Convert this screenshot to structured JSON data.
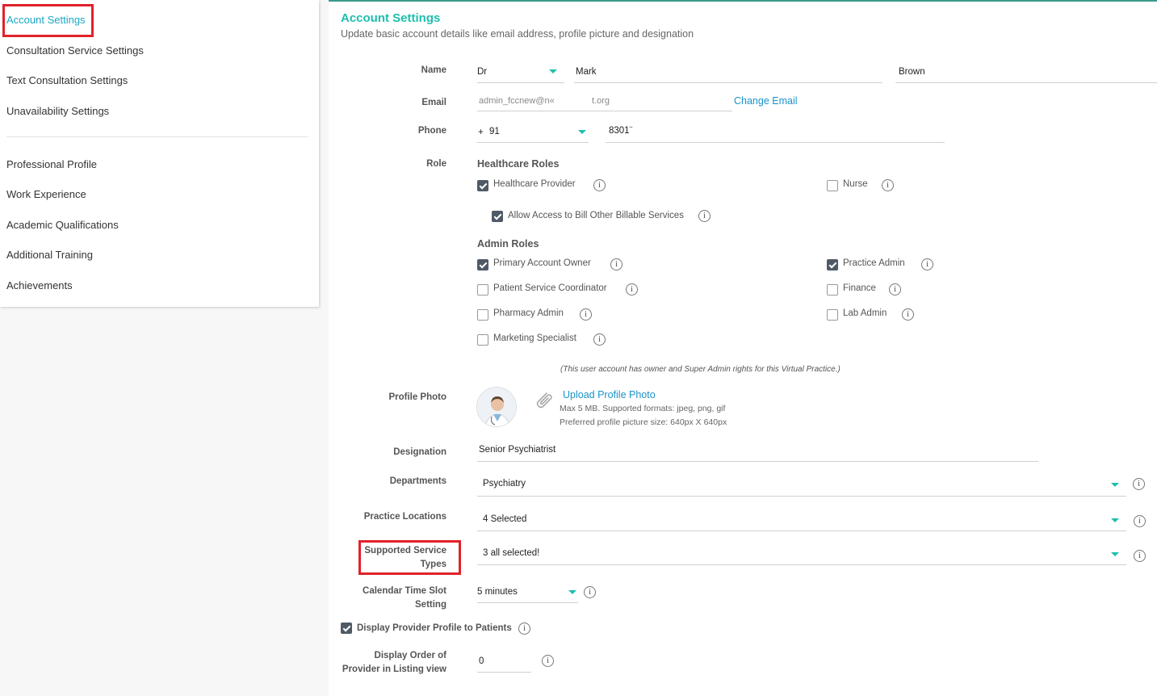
{
  "sidebar": {
    "items": [
      {
        "label": "Account Settings",
        "active": true
      },
      {
        "label": "Consultation Service Settings"
      },
      {
        "label": "Text Consultation Settings"
      },
      {
        "label": "Unavailability Settings"
      },
      {
        "label": "Professional Profile"
      },
      {
        "label": "Work Experience"
      },
      {
        "label": "Academic Qualifications"
      },
      {
        "label": "Additional Training"
      },
      {
        "label": "Achievements"
      }
    ]
  },
  "header": {
    "title": "Account Settings",
    "subtitle": "Update basic account details like email address, profile picture and designation"
  },
  "form": {
    "name": {
      "label": "Name",
      "prefix": "Dr",
      "first": "Mark",
      "last": "Brown"
    },
    "email": {
      "label": "Email",
      "value_start": "admin_fccnew@n«",
      "value_end": "t.org",
      "change_link": "Change Email"
    },
    "phone": {
      "label": "Phone",
      "plus": "+",
      "code": "91",
      "number": "8301¨"
    },
    "role": {
      "label": "Role",
      "healthcare_heading": "Healthcare Roles",
      "healthcare_provider": {
        "label": "Healthcare Provider",
        "checked": true
      },
      "nurse": {
        "label": "Nurse",
        "checked": false
      },
      "allow_billing": {
        "label": "Allow Access to Bill Other Billable Services",
        "checked": true
      },
      "admin_heading": "Admin Roles",
      "primary_owner": {
        "label": "Primary Account Owner",
        "checked": true
      },
      "practice_admin": {
        "label": "Practice Admin",
        "checked": true
      },
      "patient_coordinator": {
        "label": "Patient Service Coordinator",
        "checked": false
      },
      "finance": {
        "label": "Finance",
        "checked": false
      },
      "pharmacy_admin": {
        "label": "Pharmacy Admin",
        "checked": false
      },
      "lab_admin": {
        "label": "Lab Admin",
        "checked": false
      },
      "marketing": {
        "label": "Marketing Specialist",
        "checked": false
      },
      "note": "(This user account has owner and Super Admin rights for this Virtual Practice.)"
    },
    "photo": {
      "label": "Profile Photo",
      "upload_link": "Upload Profile Photo",
      "hint1": "Max 5 MB. Supported formats: jpeg, png, gif",
      "hint2": "Preferred profile picture size: 640px X 640px"
    },
    "designation": {
      "label": "Designation",
      "value": "Senior Psychiatrist"
    },
    "departments": {
      "label": "Departments",
      "value": "Psychiatry"
    },
    "locations": {
      "label": "Practice Locations",
      "value": "4 Selected"
    },
    "service_types": {
      "label_line1": "Supported Service",
      "label_line2": "Types",
      "value": "3 all selected!"
    },
    "time_slot": {
      "label_line1": "Calendar Time Slot",
      "label_line2": "Setting",
      "value": "5 minutes"
    },
    "display_profile": {
      "label": "Display Provider Profile to Patients",
      "checked": true
    },
    "display_order": {
      "label_line1": "Display Order of",
      "label_line2": "Provider in Listing view",
      "value": "0"
    }
  },
  "icons": {
    "info": "i",
    "paperclip": "paperclip-icon",
    "dropdown": "caret-down-icon"
  },
  "colors": {
    "accent": "#1dbfae",
    "link": "#1b93c9",
    "active_sidebar": "#1ba8c5",
    "highlight": "#e0222a",
    "checkbox": "#4f5a66"
  }
}
